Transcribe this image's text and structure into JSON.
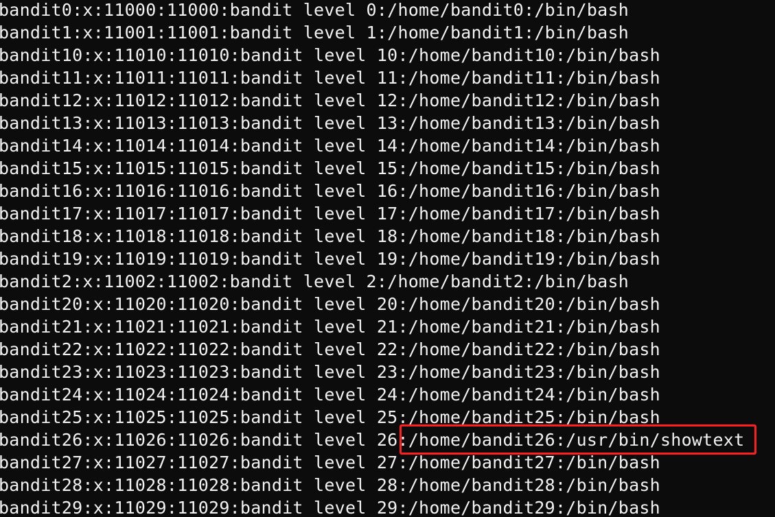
{
  "terminal": {
    "lines": [
      "bandit0:x:11000:11000:bandit level 0:/home/bandit0:/bin/bash",
      "bandit1:x:11001:11001:bandit level 1:/home/bandit1:/bin/bash",
      "bandit10:x:11010:11010:bandit level 10:/home/bandit10:/bin/bash",
      "bandit11:x:11011:11011:bandit level 11:/home/bandit11:/bin/bash",
      "bandit12:x:11012:11012:bandit level 12:/home/bandit12:/bin/bash",
      "bandit13:x:11013:11013:bandit level 13:/home/bandit13:/bin/bash",
      "bandit14:x:11014:11014:bandit level 14:/home/bandit14:/bin/bash",
      "bandit15:x:11015:11015:bandit level 15:/home/bandit15:/bin/bash",
      "bandit16:x:11016:11016:bandit level 16:/home/bandit16:/bin/bash",
      "bandit17:x:11017:11017:bandit level 17:/home/bandit17:/bin/bash",
      "bandit18:x:11018:11018:bandit level 18:/home/bandit18:/bin/bash",
      "bandit19:x:11019:11019:bandit level 19:/home/bandit19:/bin/bash",
      "bandit2:x:11002:11002:bandit level 2:/home/bandit2:/bin/bash",
      "bandit20:x:11020:11020:bandit level 20:/home/bandit20:/bin/bash",
      "bandit21:x:11021:11021:bandit level 21:/home/bandit21:/bin/bash",
      "bandit22:x:11022:11022:bandit level 22:/home/bandit22:/bin/bash",
      "bandit23:x:11023:11023:bandit level 23:/home/bandit23:/bin/bash",
      "bandit24:x:11024:11024:bandit level 24:/home/bandit24:/bin/bash",
      "bandit25:x:11025:11025:bandit level 25:/home/bandit25:/bin/bash",
      "bandit26:x:11026:11026:bandit level 26:/home/bandit26:/usr/bin/showtext",
      "bandit27:x:11027:11027:bandit level 27:/home/bandit27:/bin/bash",
      "bandit28:x:11028:11028:bandit level 28:/home/bandit28:/bin/bash",
      "bandit29:x:11029:11029:bandit level 29:/home/bandit29:/bin/bash"
    ]
  },
  "colors": {
    "background": "#0c0c0c",
    "text": "#f2f2f2",
    "highlight": "#ff1f1f"
  }
}
